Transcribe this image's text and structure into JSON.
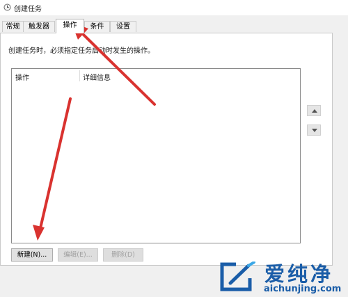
{
  "window": {
    "title": "创建任务"
  },
  "tabs": [
    {
      "label": "常规"
    },
    {
      "label": "触发器"
    },
    {
      "label": "操作",
      "active": true
    },
    {
      "label": "条件"
    },
    {
      "label": "设置"
    }
  ],
  "actions_tab": {
    "description": "创建任务时，必须指定任务启动时发生的操作。",
    "columns": [
      "操作",
      "详细信息"
    ],
    "rows": []
  },
  "buttons": {
    "new": "新建(N)...",
    "edit": "编辑(E)...",
    "delete": "删除(D)"
  },
  "scroll": {
    "up_icon": "triangle-up-icon",
    "down_icon": "triangle-down-icon"
  },
  "watermark": {
    "brand": "爱纯净",
    "url": "aichunjing.com"
  },
  "colors": {
    "arrow": "#d9322f",
    "watermark": "#1a5da8"
  }
}
